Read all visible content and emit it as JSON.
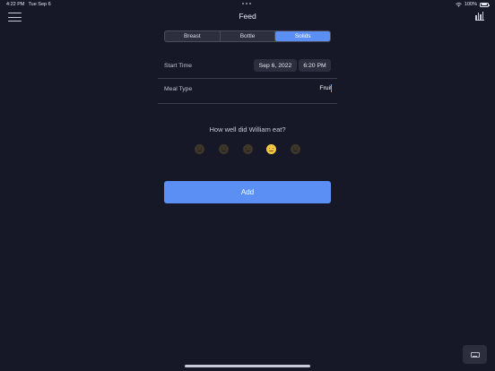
{
  "status": {
    "time": "4:22 PM",
    "date": "Tue Sep 6",
    "battery": "100%"
  },
  "nav": {
    "title": "Feed"
  },
  "tabs": [
    {
      "label": "Breast",
      "active": false
    },
    {
      "label": "Bottle",
      "active": false
    },
    {
      "label": "Solids",
      "active": true
    }
  ],
  "form": {
    "start_time_label": "Start Time",
    "start_date": "Sep 6, 2022",
    "start_time": "6:20 PM",
    "meal_type_label": "Meal Type",
    "meal_type_value": "Fruit"
  },
  "rating": {
    "question": "How well did William eat?",
    "count": 5,
    "selected_index": 3
  },
  "actions": {
    "add_label": "Add"
  },
  "colors": {
    "accent": "#5b8ff4",
    "background": "#161828",
    "field": "#2c2e3d"
  }
}
